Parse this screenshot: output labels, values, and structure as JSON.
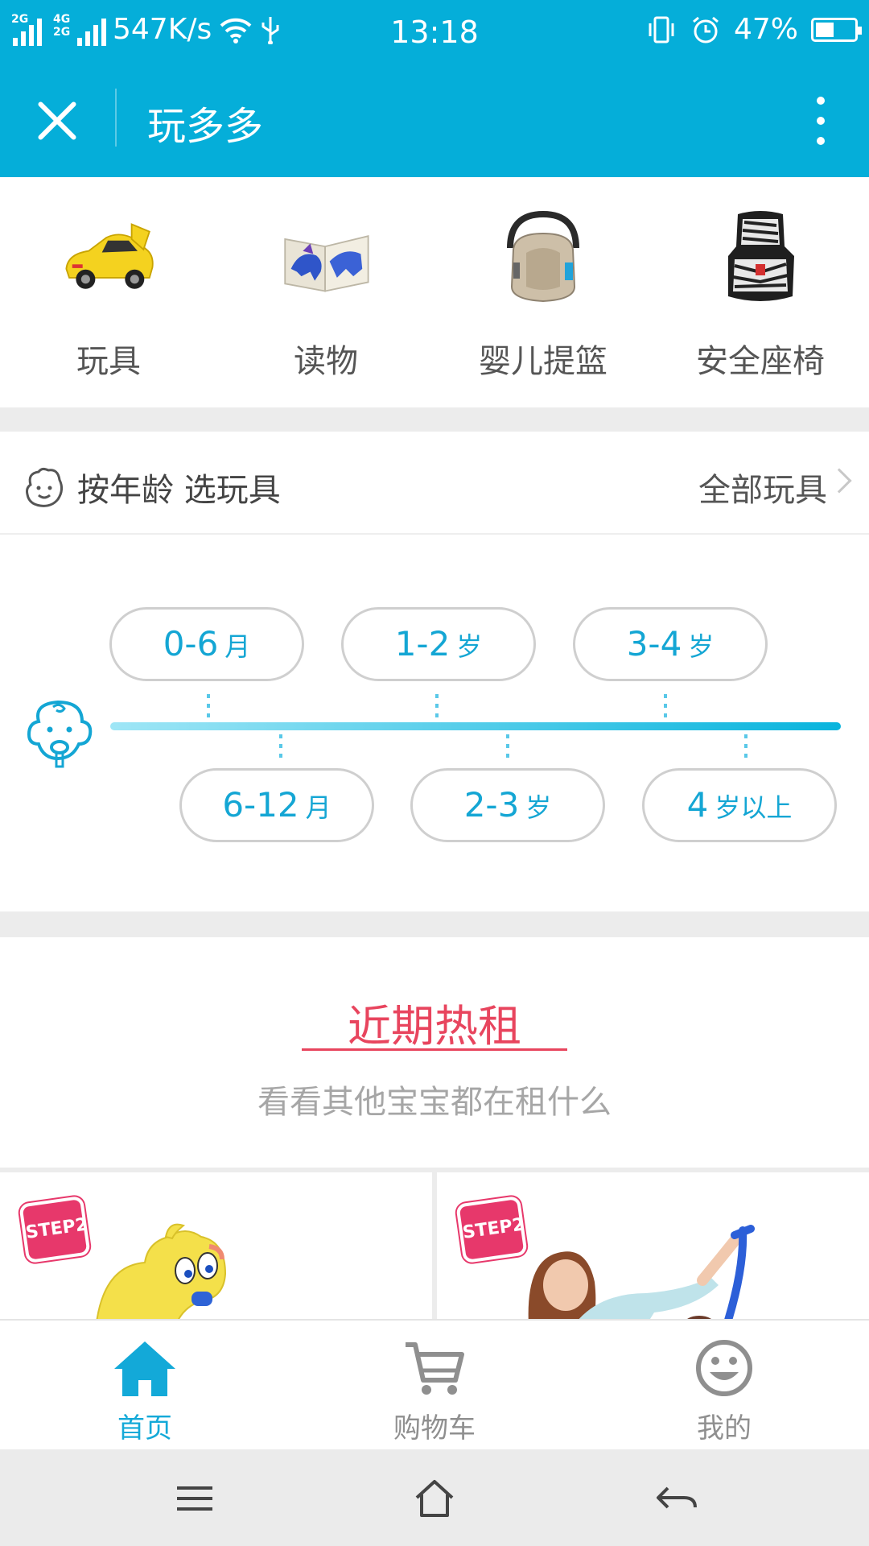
{
  "status_bar": {
    "network_speed": "547K/s",
    "time": "13:18",
    "battery_percent": "47%",
    "battery_level": 0.47,
    "network_labels": [
      "2G",
      "4G",
      "2G"
    ]
  },
  "title_bar": {
    "title": "玩多多"
  },
  "categories": [
    {
      "label": "玩具",
      "icon": "toy-car-icon"
    },
    {
      "label": "读物",
      "icon": "picture-book-icon"
    },
    {
      "label": "婴儿提篮",
      "icon": "baby-carrier-icon"
    },
    {
      "label": "安全座椅",
      "icon": "safety-seat-icon"
    }
  ],
  "age_section": {
    "title": "按年龄 选玩具",
    "all_link": "全部玩具",
    "ranges_top": [
      {
        "num": "0-6",
        "unit": "月"
      },
      {
        "num": "1-2",
        "unit": "岁"
      },
      {
        "num": "3-4",
        "unit": "岁"
      }
    ],
    "ranges_bottom": [
      {
        "num": "6-12",
        "unit": "月"
      },
      {
        "num": "2-3",
        "unit": "岁"
      },
      {
        "num": "4",
        "unit": "岁以上"
      }
    ]
  },
  "hot_rent": {
    "title": "近期热租",
    "subtitle": "看看其他宝宝都在租什么",
    "badge_text": "STEP2"
  },
  "tab_bar": {
    "tabs": [
      {
        "label": "首页",
        "icon": "home-icon",
        "active": true
      },
      {
        "label": "购物车",
        "icon": "cart-icon",
        "active": false
      },
      {
        "label": "我的",
        "icon": "smiley-icon",
        "active": false
      }
    ]
  },
  "colors": {
    "primary": "#05aed9",
    "accent_red": "#e8455e",
    "age_text": "#14a6d4"
  }
}
